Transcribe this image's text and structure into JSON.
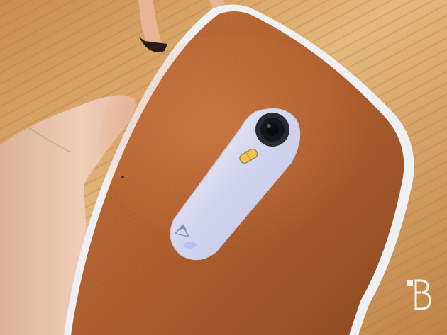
{
  "scene": {
    "description_colors": {
      "floor_light": "#d9a967",
      "floor_dark": "#a8703a",
      "leather": "#b4622f",
      "leather_dark": "#8a4522",
      "frame_white": "#e9ecef",
      "camera_strip": "#d6dbe6",
      "hand_skin": "#e9c3ad",
      "watermark": "#ffffff"
    }
  },
  "watermark": {
    "icon": "tb-logo-icon"
  }
}
